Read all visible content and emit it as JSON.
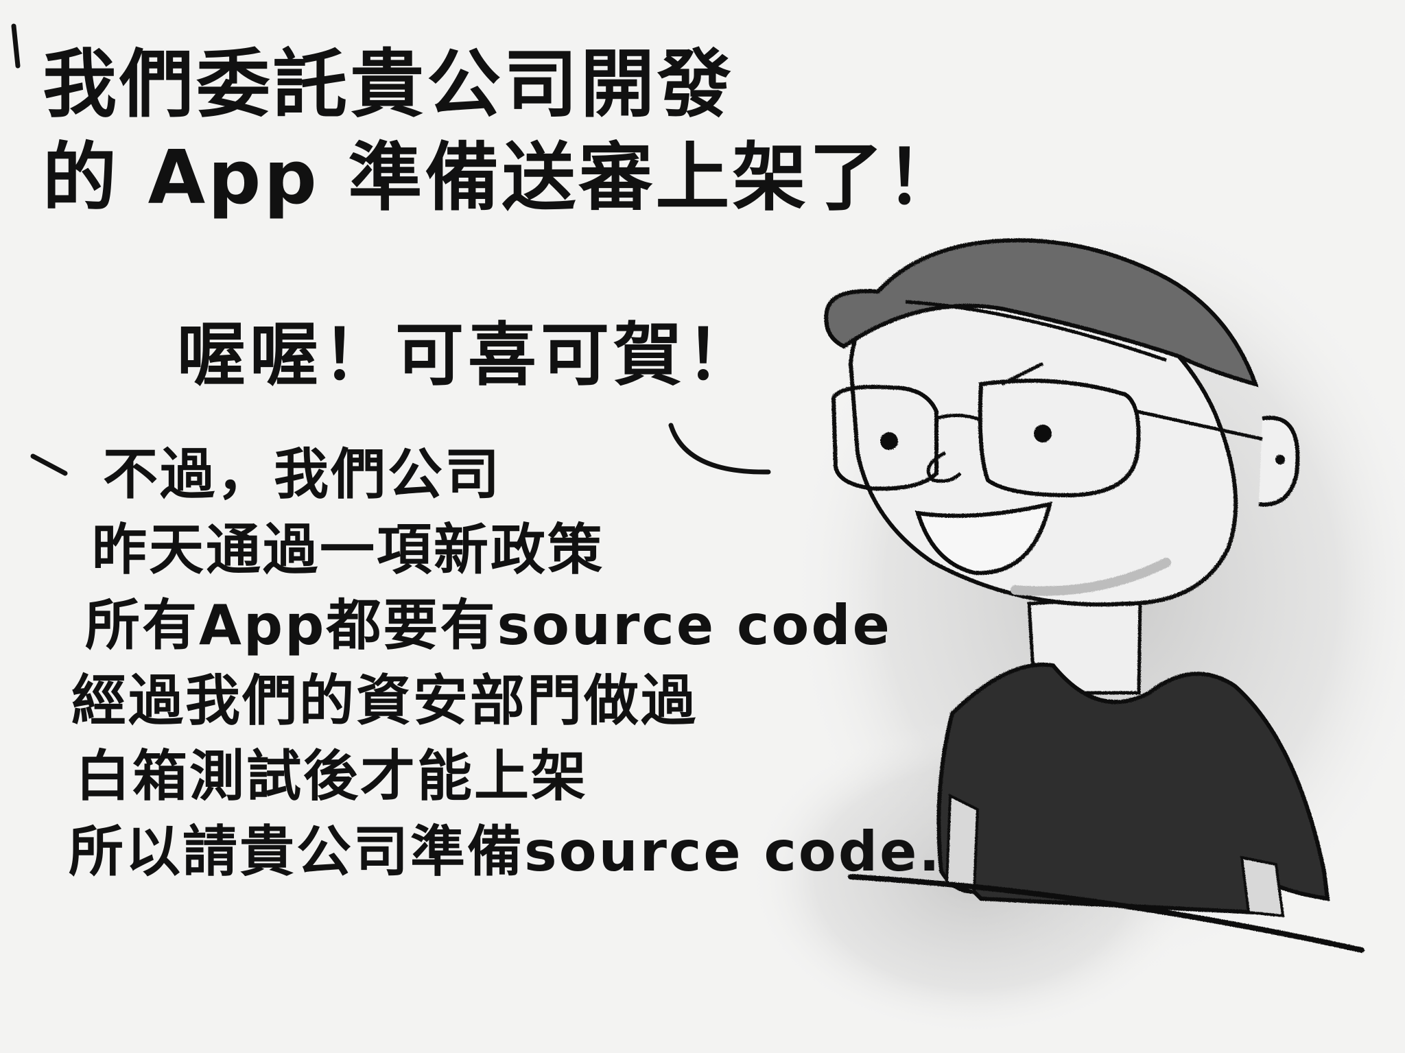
{
  "speech": {
    "request": {
      "line1": "我們委託貴公司開發",
      "line2": "的 App 準備送審上架了！"
    },
    "reply": "喔喔！可喜可賀！",
    "policy": {
      "line1": "不過，我們公司",
      "line2": "昨天通過一項新政策",
      "line3": "所有App都要有source code",
      "line4": "經過我們的資安部門做過",
      "line5": "白箱測試後才能上架",
      "line6": "所以請貴公司準備source code."
    }
  },
  "illustration": {
    "subject": "man-with-cap-and-glasses-icon",
    "palette": {
      "ink": "#111111",
      "paper": "#f3f3f2",
      "cap": "#6b6b6b",
      "shirt": "#2e2e2e",
      "shadow": "#cfcfcf"
    }
  }
}
